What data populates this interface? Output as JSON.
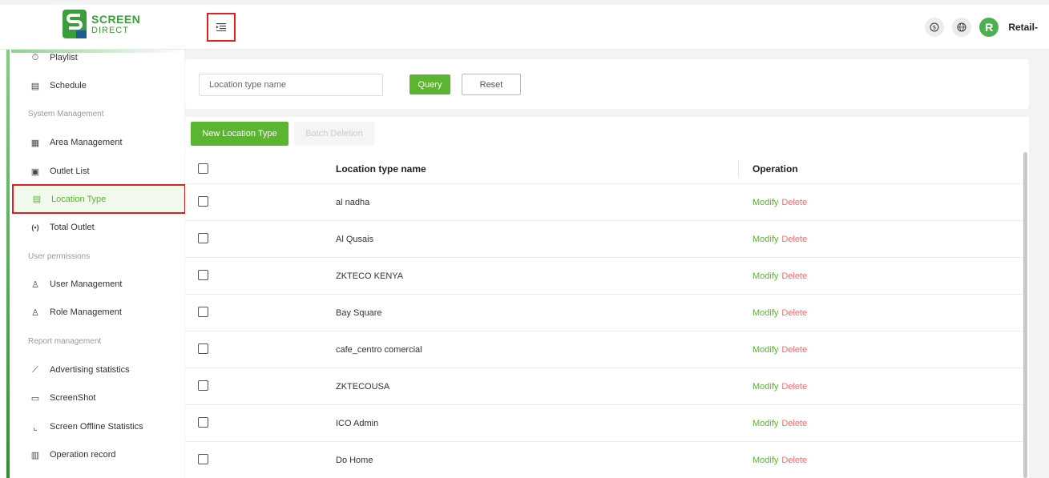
{
  "brand": {
    "name_line1": "SCREEN",
    "name_line2": "DIRECT",
    "color": "#3c9d3c"
  },
  "header": {
    "collapse_icon": "menu-fold-icon",
    "currency_icon": "dollar-circle-icon",
    "language_icon": "globe-icon",
    "avatar_initial": "R",
    "username": "Retail-"
  },
  "sidebar": {
    "items": [
      {
        "label": "Playlist",
        "icon": "clock-icon"
      },
      {
        "label": "Schedule",
        "icon": "calendar-icon"
      },
      {
        "section": "System Management"
      },
      {
        "label": "Area Management",
        "icon": "building-icon"
      },
      {
        "label": "Outlet List",
        "icon": "store-icon"
      },
      {
        "label": "Location Type",
        "icon": "location-type-icon",
        "active": true
      },
      {
        "label": "Total Outlet",
        "icon": "outlet-icon"
      },
      {
        "section": "User permissions"
      },
      {
        "label": "User Management",
        "icon": "user-icon"
      },
      {
        "label": "Role Management",
        "icon": "role-icon"
      },
      {
        "section": "Report management"
      },
      {
        "label": "Advertising statistics",
        "icon": "chart-line-icon"
      },
      {
        "label": "ScreenShot",
        "icon": "screenshot-icon"
      },
      {
        "label": "Screen Offline Statistics",
        "icon": "stats-icon"
      },
      {
        "label": "Operation record",
        "icon": "record-icon"
      }
    ]
  },
  "search": {
    "placeholder": "Location type name",
    "query_label": "Query",
    "reset_label": "Reset"
  },
  "toolbar": {
    "new_label": "New Location Type",
    "batch_delete_label": "Batch Deletion"
  },
  "table": {
    "columns": [
      "Location type name",
      "Operation"
    ],
    "rows": [
      {
        "name": "al nadha"
      },
      {
        "name": "Al Qusais"
      },
      {
        "name": "ZKTECO KENYA"
      },
      {
        "name": "Bay Square"
      },
      {
        "name": "cafe_centro comercial"
      },
      {
        "name": "ZKTECOUSA"
      },
      {
        "name": "ICO Admin"
      },
      {
        "name": "Do Home"
      }
    ],
    "modify_label": "Modify",
    "delete_label": "Delete"
  },
  "colors": {
    "accent": "#5cb531",
    "danger": "#f56c6c",
    "highlight_border": "#e02020"
  }
}
